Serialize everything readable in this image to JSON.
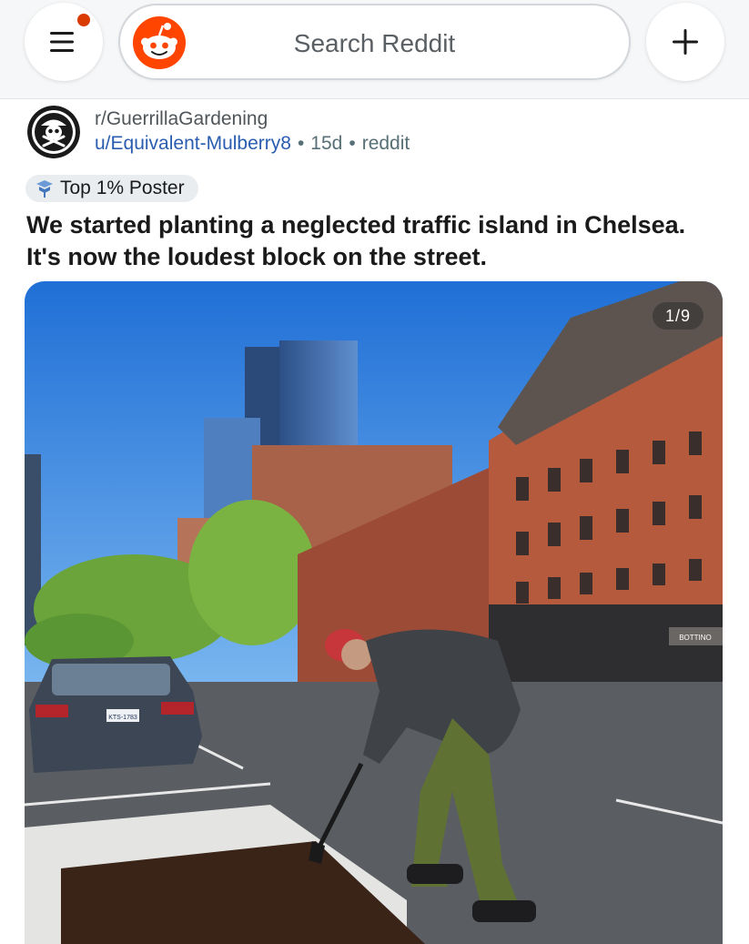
{
  "header": {
    "search_placeholder": "Search Reddit",
    "has_notification": true
  },
  "post": {
    "subreddit": "r/GuerrillaGardening",
    "username": "u/Equivalent-Mulberry8",
    "age": "15d",
    "source": "reddit",
    "separator": "•",
    "flair": "Top 1% Poster",
    "title": "We started planting a neglected traffic island in Chelsea. It's now the loudest block on the street.",
    "gallery_counter": "1/9",
    "image_signs": {
      "license_plate": "KTS-1783",
      "awning": "BOTTINO"
    }
  },
  "colors": {
    "brand": "#ff4500",
    "notification": "#d93a00",
    "username_link": "#2a5db0",
    "sky": "#2f7fe0"
  },
  "icons": {
    "menu": "hamburger-menu-icon",
    "create": "plus-icon",
    "logo": "reddit-snoo-logo-icon",
    "flair": "top-poster-badge-icon"
  }
}
